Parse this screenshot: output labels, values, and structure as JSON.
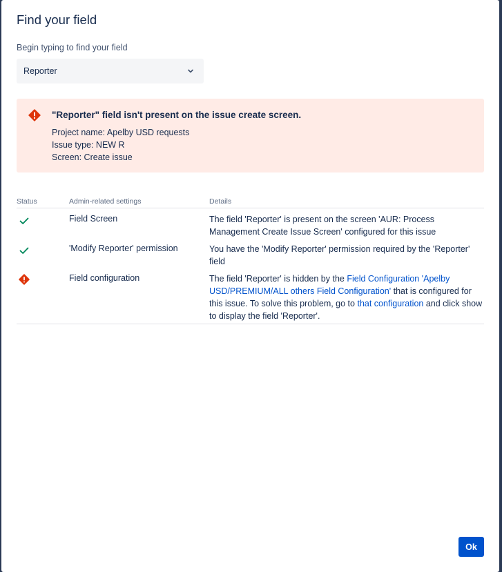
{
  "dialog": {
    "title": "Find your field",
    "search_label": "Begin typing to find your field",
    "selected_field": "Reporter"
  },
  "alert": {
    "title": "\"Reporter\" field isn't present on the issue create screen.",
    "project": "Project name: Apelby USD requests",
    "issue_type": "Issue type: NEW R",
    "screen": "Screen: Create issue",
    "icon": "error-icon"
  },
  "table": {
    "headers": [
      "Status",
      "Admin-related settings",
      "Details"
    ],
    "rows": [
      {
        "status": "ok",
        "status_icon": "checkmark-icon",
        "setting": "Field Screen",
        "details": "The field 'Reporter' is present on the screen 'AUR: Process Management Create Issue Screen' configured for this issue"
      },
      {
        "status": "ok",
        "status_icon": "checkmark-icon",
        "setting": "'Modify Reporter' permission",
        "details": "You have the 'Modify Reporter' permission required by the 'Reporter' field"
      },
      {
        "status": "error",
        "status_icon": "error-icon",
        "setting": "Field configuration",
        "details_pre": "The field 'Reporter' is hidden by the ",
        "details_link1": "Field Configuration 'Apelby USD/PREMIUM/ALL others Field Configuration'",
        "details_mid": " that is configured for this issue. To solve this problem, go to ",
        "details_link2": "that configuration",
        "details_post": " and click show to display the field 'Reporter'."
      }
    ]
  },
  "footer": {
    "ok_label": "Ok"
  },
  "colors": {
    "primary": "#0052cc",
    "success": "#00875a",
    "danger": "#de350b",
    "alert_bg": "#ffebe6"
  }
}
